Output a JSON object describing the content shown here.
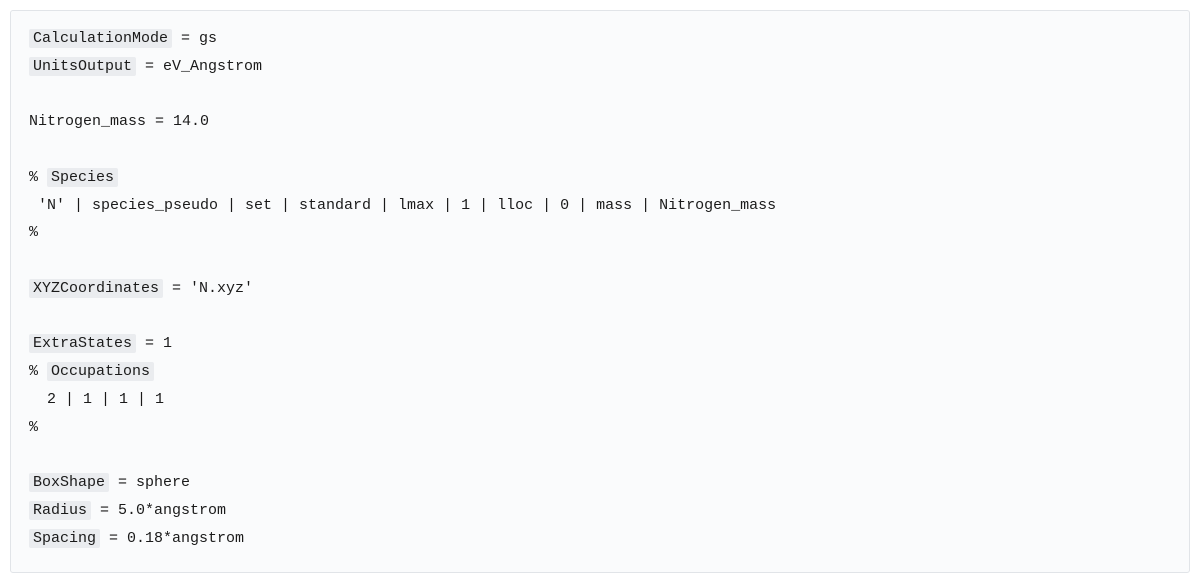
{
  "code": {
    "line1_var": "CalculationMode",
    "line1_rest": " = gs",
    "line2_var": "UnitsOutput",
    "line2_rest": " = eV_Angstrom",
    "line3": "",
    "line4": "Nitrogen_mass = 14.0",
    "line5": "",
    "line6_prefix": "% ",
    "line6_block": "Species",
    "line7": " 'N' | species_pseudo | set | standard | lmax | 1 | lloc | 0 | mass | Nitrogen_mass",
    "line8": "%",
    "line9": "",
    "line10_var": "XYZCoordinates",
    "line10_rest": " = 'N.xyz'",
    "line11": "",
    "line12_var": "ExtraStates",
    "line12_rest": " = 1",
    "line13_prefix": "% ",
    "line13_block": "Occupations",
    "line14": "  2 | 1 | 1 | 1",
    "line15": "%",
    "line16": "",
    "line17_var": "BoxShape",
    "line17_rest": " = sphere",
    "line18_var": "Radius",
    "line18_rest": " = 5.0*angstrom",
    "line19_var": "Spacing",
    "line19_rest": " = 0.18*angstrom"
  }
}
